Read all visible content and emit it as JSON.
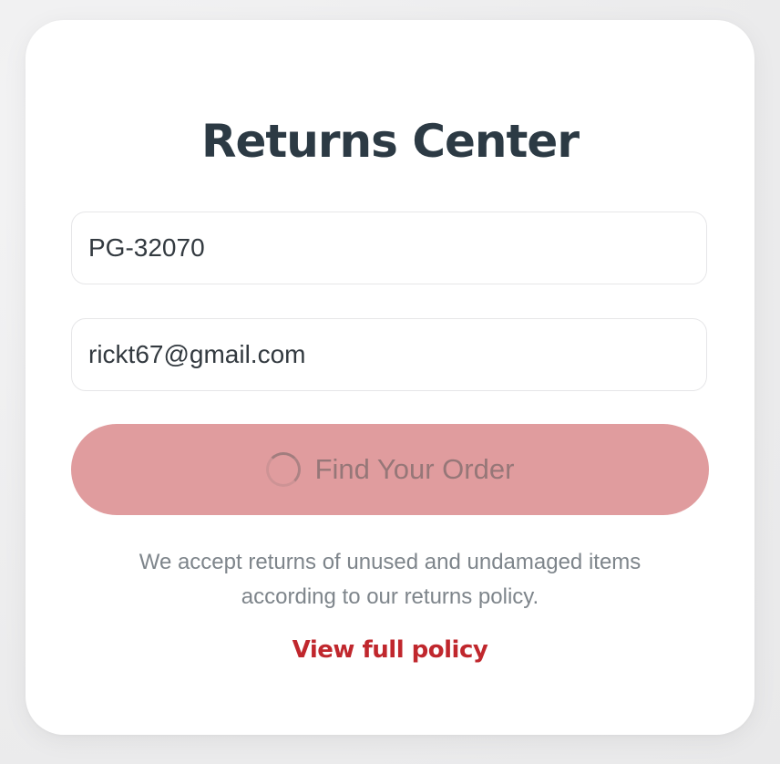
{
  "page": {
    "title": "Returns Center"
  },
  "form": {
    "order_number": "PG-32070",
    "email": "rickt67@gmail.com",
    "submit_label": "Find Your Order",
    "submit_state": "loading"
  },
  "info": {
    "line1": "We accept returns of unused and undamaged items",
    "line2": "according to our returns policy."
  },
  "policy_link": {
    "label": "View full policy"
  },
  "colors": {
    "title": "#2c3a44",
    "button_background": "#e09c9e",
    "link": "#c0272d",
    "note_text": "#7e858b"
  },
  "icons": {
    "button_spinner": "loading-spinner-icon"
  }
}
